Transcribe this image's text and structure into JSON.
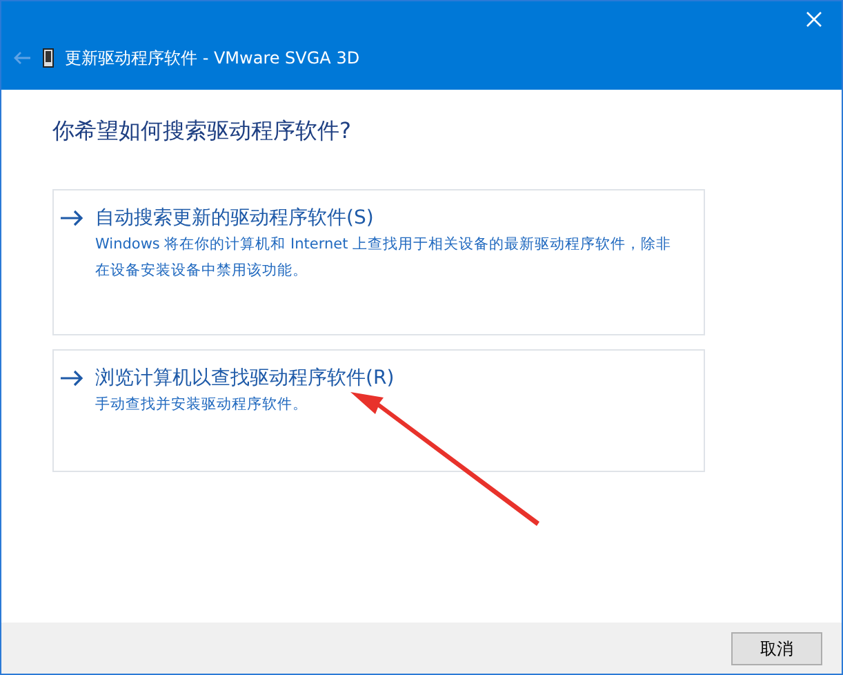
{
  "window": {
    "title": "更新驱动程序软件 - VMware SVGA 3D"
  },
  "heading": "你希望如何搜索驱动程序软件?",
  "options": [
    {
      "title": "自动搜索更新的驱动程序软件(S)",
      "description": "Windows 将在你的计算机和 Internet 上查找用于相关设备的最新驱动程序软件，除非在设备安装设备中禁用该功能。"
    },
    {
      "title": "浏览计算机以查找驱动程序软件(R)",
      "description": "手动查找并安装驱动程序软件。"
    }
  ],
  "buttons": [
    {
      "label": "取消"
    }
  ]
}
